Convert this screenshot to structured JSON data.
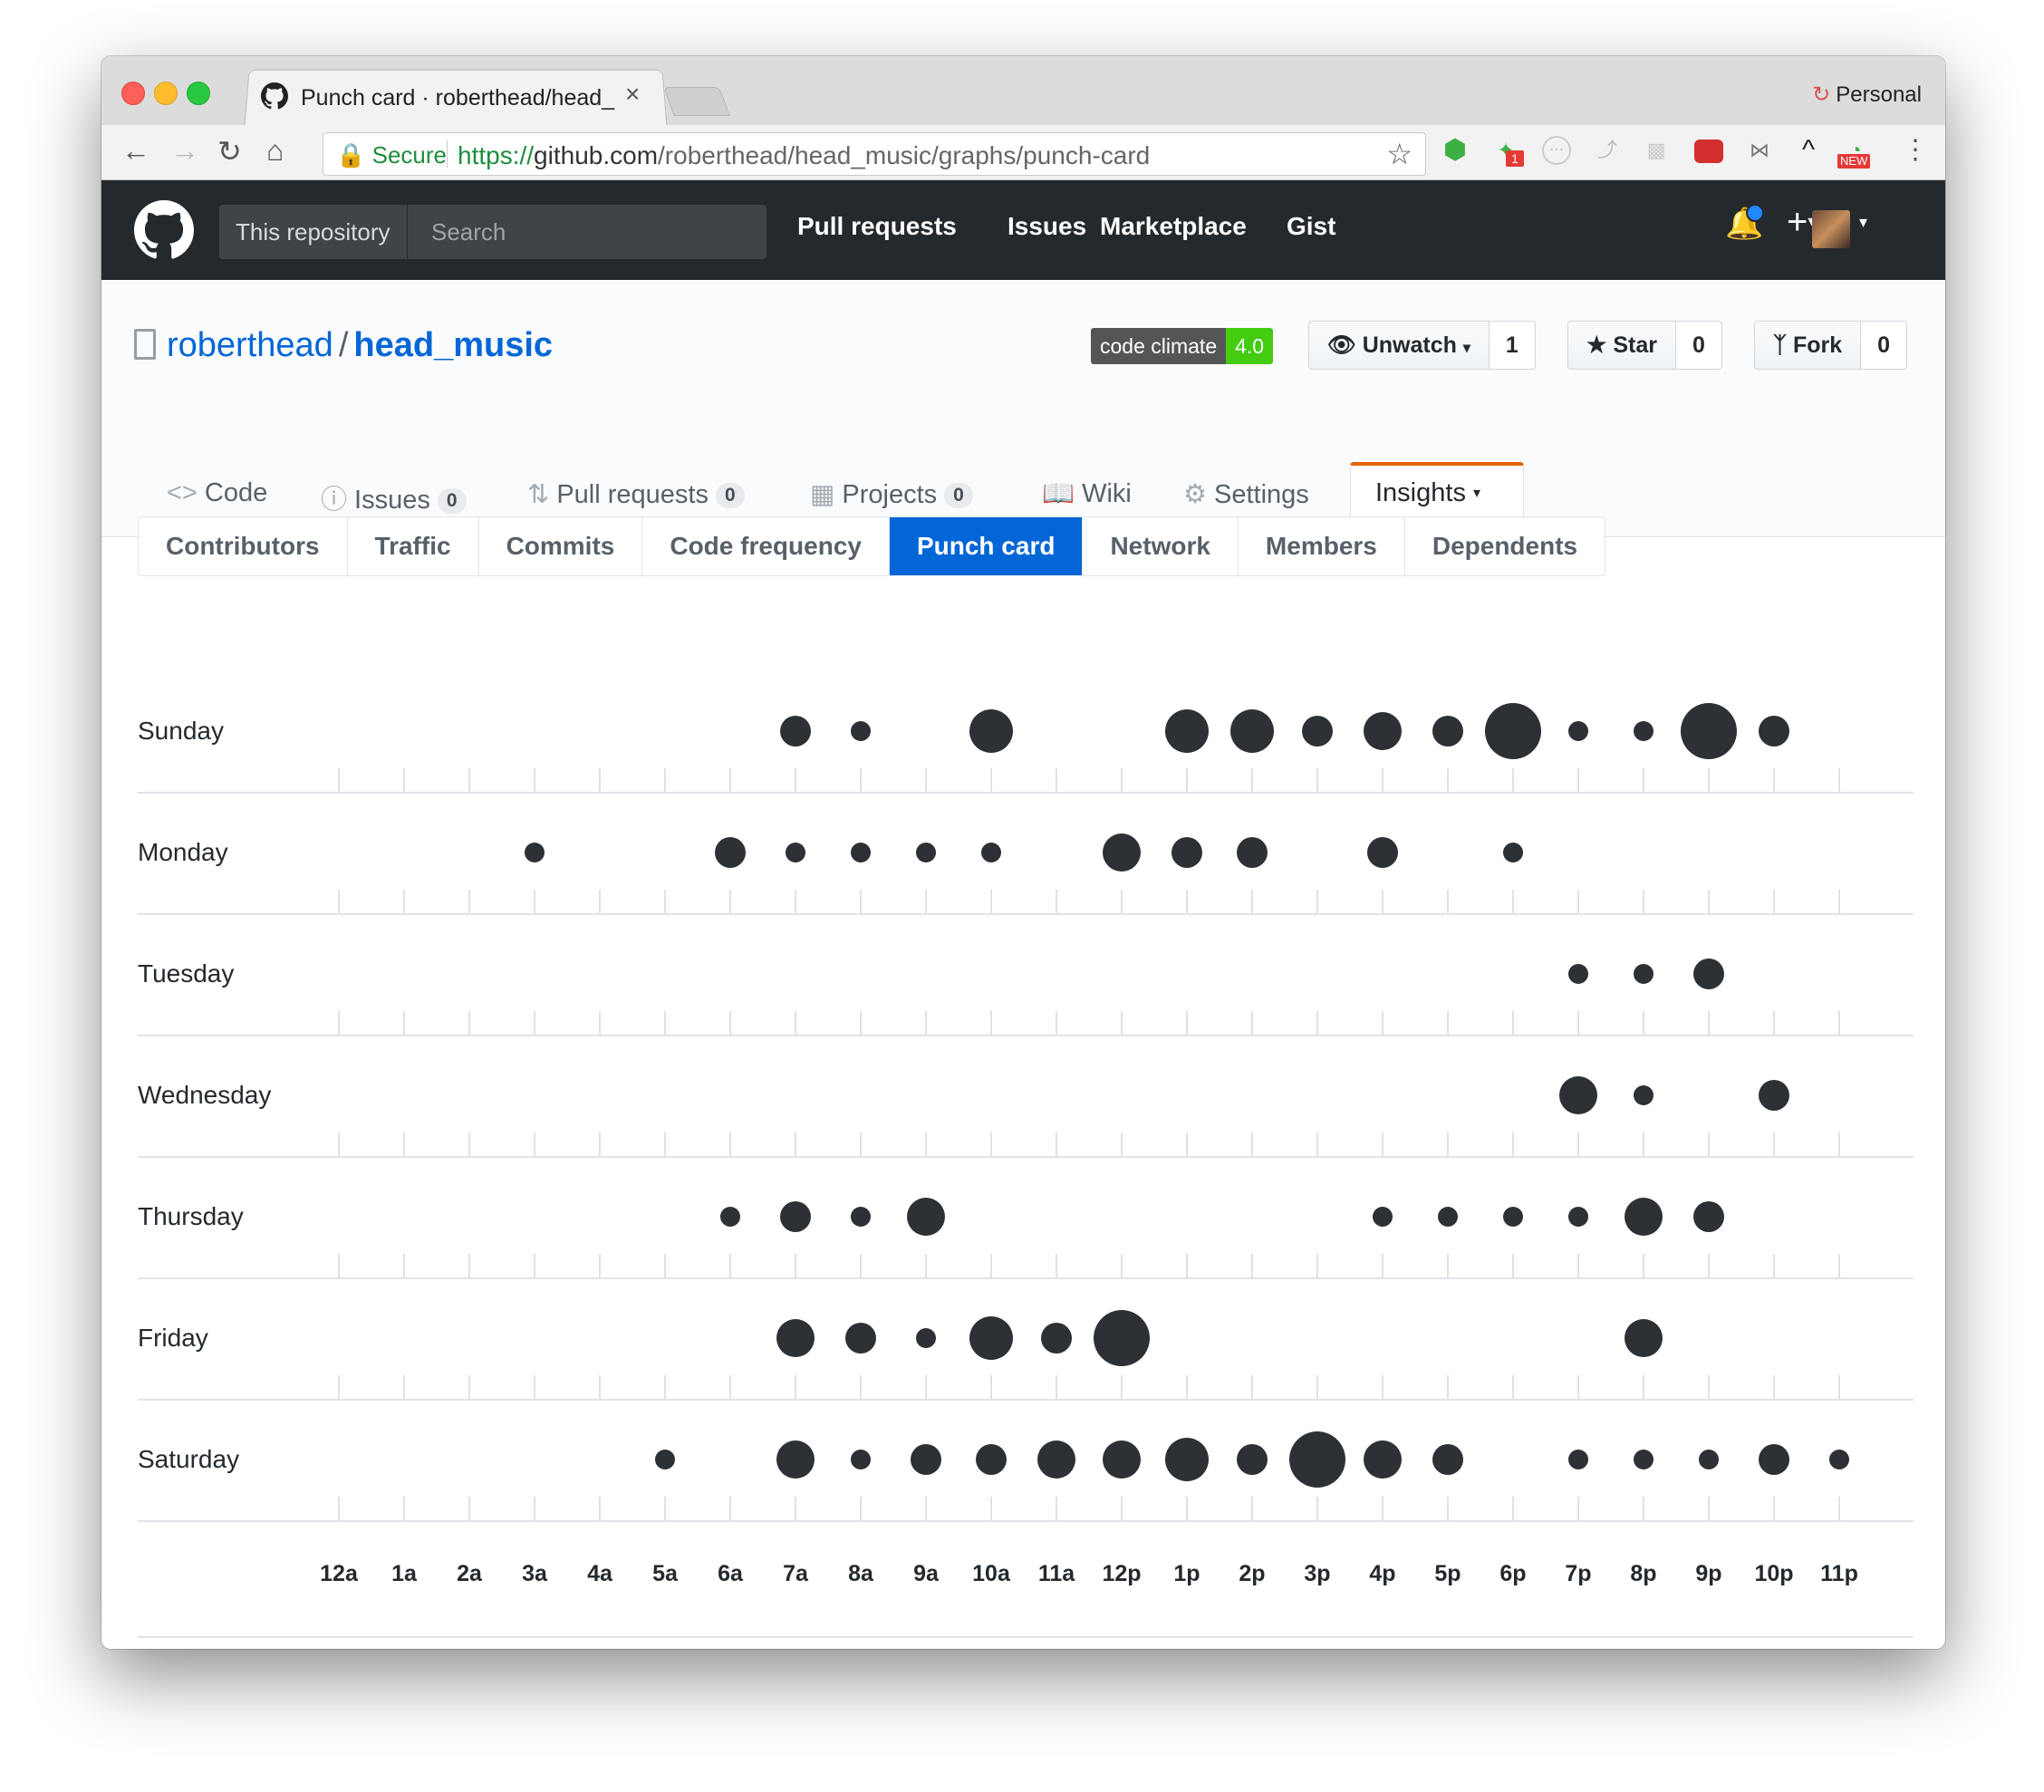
{
  "browser": {
    "tab_title": "Punch card · roberthead/head_",
    "tab_close": "×",
    "profile": "Personal",
    "secure_label": "Secure",
    "url_scheme": "https://",
    "url_host": "github.com",
    "url_path": "/roberthead/head_music/graphs/punch-card",
    "ext_badge": "1",
    "ext_new": "NEW"
  },
  "header": {
    "scope": "This repository",
    "search_placeholder": "Search",
    "nav": [
      "Pull requests",
      "Issues",
      "Marketplace",
      "Gist"
    ]
  },
  "repo": {
    "owner": "roberthead",
    "separator": "/",
    "name": "head_music",
    "badge_label": "code climate",
    "badge_value": "4.0",
    "unwatch_label": "Unwatch",
    "unwatch_count": "1",
    "star_label": "Star",
    "star_count": "0",
    "fork_label": "Fork",
    "fork_count": "0"
  },
  "reponav": {
    "code": "Code",
    "issues": "Issues",
    "issues_count": "0",
    "pulls": "Pull requests",
    "pulls_count": "0",
    "projects": "Projects",
    "projects_count": "0",
    "wiki": "Wiki",
    "settings": "Settings",
    "insights": "Insights"
  },
  "subnav": [
    "Contributors",
    "Traffic",
    "Commits",
    "Code frequency",
    "Punch card",
    "Network",
    "Members",
    "Dependents"
  ],
  "subnav_active": "Punch card",
  "chart_data": {
    "type": "scatter",
    "days": [
      "Sunday",
      "Monday",
      "Tuesday",
      "Wednesday",
      "Thursday",
      "Friday",
      "Saturday"
    ],
    "hours": [
      "12a",
      "1a",
      "2a",
      "3a",
      "4a",
      "5a",
      "6a",
      "7a",
      "8a",
      "9a",
      "10a",
      "11a",
      "12p",
      "1p",
      "2p",
      "3p",
      "4p",
      "5p",
      "6p",
      "7p",
      "8p",
      "9p",
      "10p",
      "11p"
    ],
    "size_legend": "relative commit count (1 = smallest dot, 5 = largest)",
    "points": [
      {
        "day": "Sunday",
        "hour": "7a",
        "size": 2
      },
      {
        "day": "Sunday",
        "hour": "8a",
        "size": 1
      },
      {
        "day": "Sunday",
        "hour": "10a",
        "size": 4
      },
      {
        "day": "Sunday",
        "hour": "1p",
        "size": 4
      },
      {
        "day": "Sunday",
        "hour": "2p",
        "size": 4
      },
      {
        "day": "Sunday",
        "hour": "3p",
        "size": 2
      },
      {
        "day": "Sunday",
        "hour": "4p",
        "size": 3
      },
      {
        "day": "Sunday",
        "hour": "5p",
        "size": 2
      },
      {
        "day": "Sunday",
        "hour": "6p",
        "size": 5
      },
      {
        "day": "Sunday",
        "hour": "7p",
        "size": 1
      },
      {
        "day": "Sunday",
        "hour": "8p",
        "size": 1
      },
      {
        "day": "Sunday",
        "hour": "9p",
        "size": 5
      },
      {
        "day": "Sunday",
        "hour": "10p",
        "size": 2
      },
      {
        "day": "Monday",
        "hour": "3a",
        "size": 1
      },
      {
        "day": "Monday",
        "hour": "6a",
        "size": 2
      },
      {
        "day": "Monday",
        "hour": "7a",
        "size": 1
      },
      {
        "day": "Monday",
        "hour": "8a",
        "size": 1
      },
      {
        "day": "Monday",
        "hour": "9a",
        "size": 1
      },
      {
        "day": "Monday",
        "hour": "10a",
        "size": 1
      },
      {
        "day": "Monday",
        "hour": "12p",
        "size": 3
      },
      {
        "day": "Monday",
        "hour": "1p",
        "size": 2
      },
      {
        "day": "Monday",
        "hour": "2p",
        "size": 2
      },
      {
        "day": "Monday",
        "hour": "4p",
        "size": 2
      },
      {
        "day": "Monday",
        "hour": "6p",
        "size": 1
      },
      {
        "day": "Tuesday",
        "hour": "7p",
        "size": 1
      },
      {
        "day": "Tuesday",
        "hour": "8p",
        "size": 1
      },
      {
        "day": "Tuesday",
        "hour": "9p",
        "size": 2
      },
      {
        "day": "Wednesday",
        "hour": "7p",
        "size": 3
      },
      {
        "day": "Wednesday",
        "hour": "8p",
        "size": 1
      },
      {
        "day": "Wednesday",
        "hour": "10p",
        "size": 2
      },
      {
        "day": "Thursday",
        "hour": "6a",
        "size": 1
      },
      {
        "day": "Thursday",
        "hour": "7a",
        "size": 2
      },
      {
        "day": "Thursday",
        "hour": "8a",
        "size": 1
      },
      {
        "day": "Thursday",
        "hour": "9a",
        "size": 3
      },
      {
        "day": "Thursday",
        "hour": "4p",
        "size": 1
      },
      {
        "day": "Thursday",
        "hour": "5p",
        "size": 1
      },
      {
        "day": "Thursday",
        "hour": "6p",
        "size": 1
      },
      {
        "day": "Thursday",
        "hour": "7p",
        "size": 1
      },
      {
        "day": "Thursday",
        "hour": "8p",
        "size": 3
      },
      {
        "day": "Thursday",
        "hour": "9p",
        "size": 2
      },
      {
        "day": "Friday",
        "hour": "7a",
        "size": 3
      },
      {
        "day": "Friday",
        "hour": "8a",
        "size": 2
      },
      {
        "day": "Friday",
        "hour": "9a",
        "size": 1
      },
      {
        "day": "Friday",
        "hour": "10a",
        "size": 4
      },
      {
        "day": "Friday",
        "hour": "11a",
        "size": 2
      },
      {
        "day": "Friday",
        "hour": "12p",
        "size": 5
      },
      {
        "day": "Friday",
        "hour": "8p",
        "size": 3
      },
      {
        "day": "Saturday",
        "hour": "5a",
        "size": 1
      },
      {
        "day": "Saturday",
        "hour": "7a",
        "size": 3
      },
      {
        "day": "Saturday",
        "hour": "8a",
        "size": 1
      },
      {
        "day": "Saturday",
        "hour": "9a",
        "size": 2
      },
      {
        "day": "Saturday",
        "hour": "10a",
        "size": 2
      },
      {
        "day": "Saturday",
        "hour": "11a",
        "size": 3
      },
      {
        "day": "Saturday",
        "hour": "12p",
        "size": 3
      },
      {
        "day": "Saturday",
        "hour": "1p",
        "size": 4
      },
      {
        "day": "Saturday",
        "hour": "2p",
        "size": 2
      },
      {
        "day": "Saturday",
        "hour": "3p",
        "size": 5
      },
      {
        "day": "Saturday",
        "hour": "4p",
        "size": 3
      },
      {
        "day": "Saturday",
        "hour": "5p",
        "size": 2
      },
      {
        "day": "Saturday",
        "hour": "7p",
        "size": 1
      },
      {
        "day": "Saturday",
        "hour": "8p",
        "size": 1
      },
      {
        "day": "Saturday",
        "hour": "9p",
        "size": 1
      },
      {
        "day": "Saturday",
        "hour": "10p",
        "size": 2
      },
      {
        "day": "Saturday",
        "hour": "11p",
        "size": 1
      }
    ]
  }
}
